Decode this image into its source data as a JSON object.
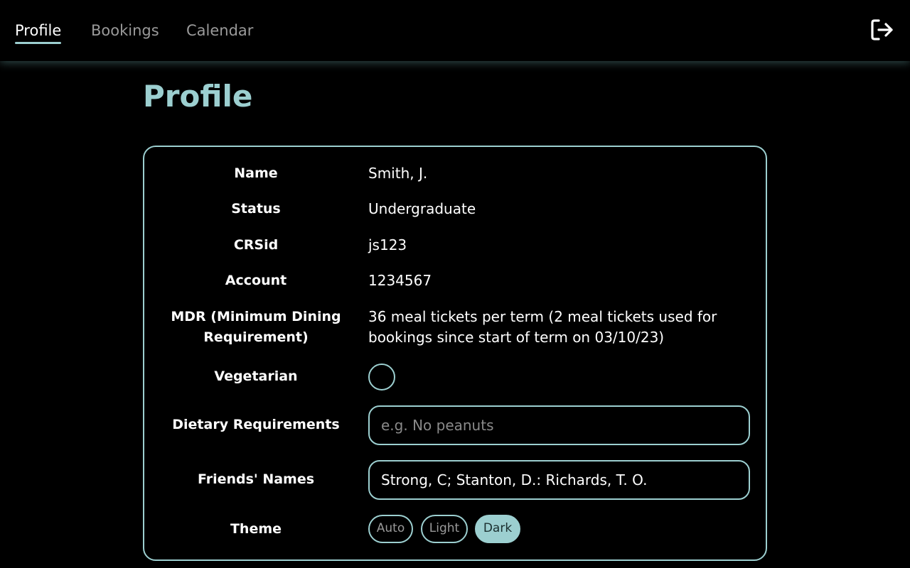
{
  "nav": {
    "tabs": [
      {
        "label": "Profile",
        "active": true
      },
      {
        "label": "Bookings",
        "active": false
      },
      {
        "label": "Calendar",
        "active": false
      }
    ],
    "logout_icon": "logout-icon"
  },
  "page": {
    "title": "Profile"
  },
  "profile": {
    "name_label": "Name",
    "name_value": "Smith, J.",
    "status_label": "Status",
    "status_value": "Undergraduate",
    "crsid_label": "CRSid",
    "crsid_value": "js123",
    "account_label": "Account",
    "account_value": "1234567",
    "mdr_label": "MDR (Minimum Dining Requirement)",
    "mdr_value": "36 meal tickets per term (2 meal tickets used for bookings since start of term on 03/10/23)",
    "vegetarian_label": "Vegetarian",
    "vegetarian_checked": false,
    "dietary_label": "Dietary Requirements",
    "dietary_placeholder": "e.g. No peanuts",
    "dietary_value": "",
    "friends_label": "Friends' Names",
    "friends_value": "Strong, C; Stanton, D.: Richards, T. O.",
    "theme_label": "Theme",
    "theme_options": [
      "Auto",
      "Light",
      "Dark"
    ],
    "theme_selected": "Dark"
  },
  "colors": {
    "accent": "#9ccfd0",
    "background": "#000000",
    "text": "#ffffff",
    "muted": "#9a9a9a"
  }
}
